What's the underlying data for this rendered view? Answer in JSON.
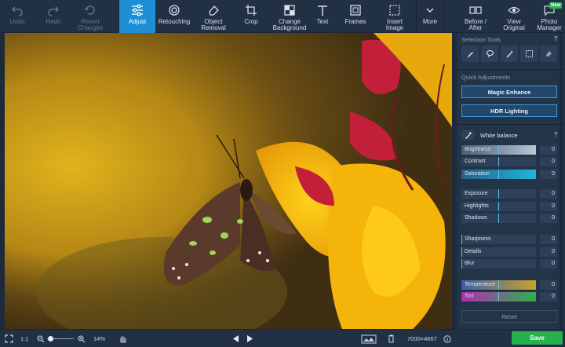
{
  "toolbar": {
    "undo": "Undo",
    "redo": "Redo",
    "revert": "Revert\nChanges",
    "adjust": "Adjust",
    "retouching": "Retouching",
    "object_removal": "Object\nRemoval",
    "crop": "Crop",
    "change_background": "Change\nBackground",
    "text": "Text",
    "frames": "Frames",
    "insert_image": "Insert\nImage",
    "more": "More",
    "before_after": "Before /\nAfter",
    "view_original": "View\nOriginal",
    "photo_manager": "Photo\nManager",
    "new_badge": "New"
  },
  "panel": {
    "selection_tools": "Selection Tools",
    "quick_adjustments": "Quick Adjustments",
    "magic_enhance": "Magic Enhance",
    "hdr_lighting": "HDR Lighting",
    "white_balance": "White balance",
    "help": "?",
    "sliders": [
      {
        "label": "Brightness",
        "value": "0",
        "level": 1.0
      },
      {
        "label": "Contrast",
        "value": "0",
        "level": 0.5
      },
      {
        "label": "Saturation",
        "value": "0",
        "level": 1.0
      },
      {
        "label": "Exposure",
        "value": "0",
        "level": 0.5
      },
      {
        "label": "Highlights",
        "value": "0",
        "level": 0.5
      },
      {
        "label": "Shadows",
        "value": "0",
        "level": 0.5
      },
      {
        "label": "Sharpness",
        "value": "0",
        "level": 0.0
      },
      {
        "label": "Details",
        "value": "0",
        "level": 0.0
      },
      {
        "label": "Blur",
        "value": "0",
        "level": 0.0
      },
      {
        "label": "Temperature",
        "value": "0",
        "level": 0.5
      },
      {
        "label": "Tint",
        "value": "0",
        "level": 0.5
      }
    ],
    "reset": "Reset"
  },
  "bottom": {
    "fit_ratio": "1:1",
    "zoom": "14%",
    "dimensions": "7000×4667",
    "save": "Save"
  },
  "colors": {
    "accent": "#1e8fd6",
    "save": "#27b04e"
  }
}
